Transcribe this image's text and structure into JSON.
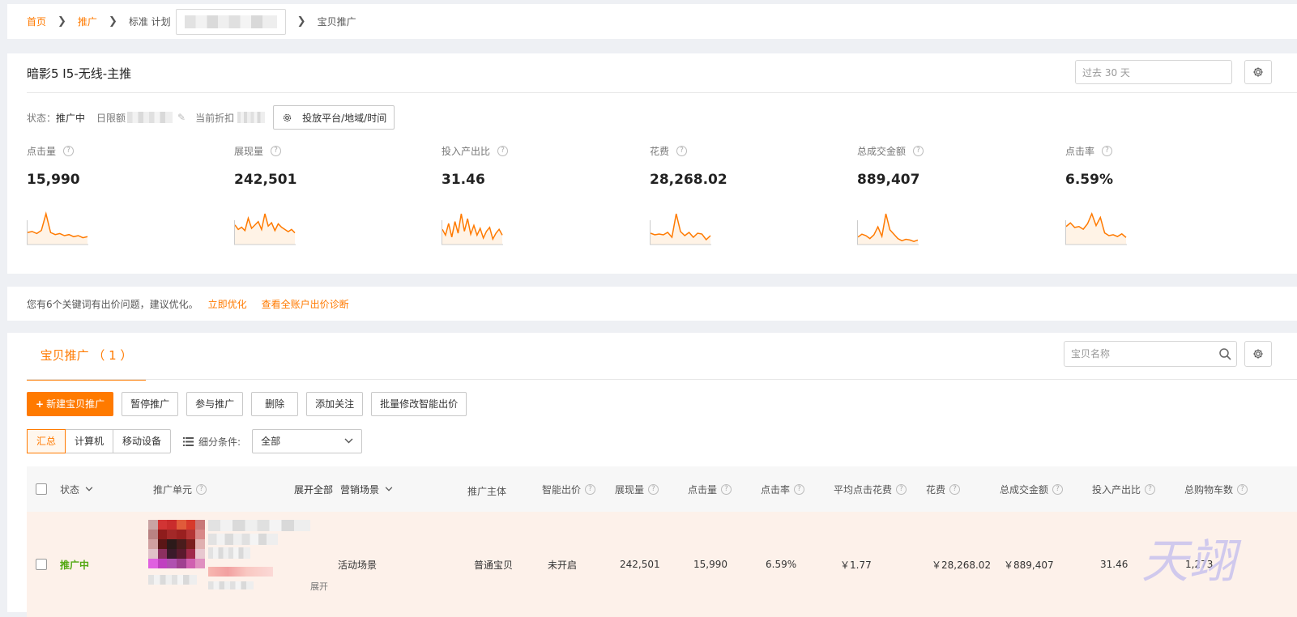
{
  "breadcrumb": {
    "home": "首页",
    "promo": "推广",
    "plan_prefix": "标准 计划",
    "current": "宝贝推广"
  },
  "overview": {
    "title": "暗影5 I5-无线-主推",
    "date_placeholder": "过去 30 天",
    "status_label": "状态：",
    "status_value": "推广中",
    "daily_limit_label": "日限额",
    "discount_label": "当前折扣",
    "platform_button": "投放平台/地域/时间",
    "metrics": [
      {
        "label": "点击量",
        "value": "15,990",
        "trend": [
          10,
          11,
          9,
          12,
          28,
          10,
          8,
          9,
          7,
          8,
          6,
          7,
          5,
          6
        ]
      },
      {
        "label": "展现量",
        "value": "242,501",
        "trend": [
          16,
          12,
          14,
          11,
          22,
          13,
          16,
          19,
          12,
          26,
          15,
          18,
          11,
          17,
          14,
          12,
          10,
          12,
          9
        ]
      },
      {
        "label": "投入产出比",
        "value": "31.46",
        "trend": [
          14,
          8,
          20,
          6,
          22,
          10,
          30,
          12,
          25,
          9,
          18,
          8,
          15,
          5,
          12,
          16,
          4,
          10,
          14,
          8
        ]
      },
      {
        "label": "花费",
        "value": "28,268.02",
        "trend": [
          12,
          10,
          11,
          10,
          13,
          7,
          36,
          14,
          9,
          13,
          7,
          12,
          11,
          4,
          9
        ]
      },
      {
        "label": "总成交金额",
        "value": "889,407",
        "trend": [
          8,
          12,
          10,
          6,
          11,
          22,
          9,
          40,
          18,
          12,
          6,
          3,
          5,
          4,
          2,
          4
        ]
      },
      {
        "label": "点击率",
        "value": "6.59%",
        "trend": [
          18,
          22,
          17,
          18,
          15,
          21,
          32,
          19,
          28,
          11,
          8,
          9,
          7,
          10,
          6
        ]
      }
    ],
    "accent_color": "#ff7a00"
  },
  "tip": {
    "text": "您有6个关键词有出价问题，建议优化。",
    "link1": "立即优化",
    "link2": "查看全账户出价诊断"
  },
  "list": {
    "tab_label": "宝贝推广 （ 1 ）",
    "search_placeholder": "宝贝名称",
    "buttons": {
      "new": "新建宝贝推广",
      "pause": "暂停推广",
      "join": "参与推广",
      "delete": "删除",
      "follow": "添加关注",
      "batch_bid": "批量修改智能出价"
    },
    "devices": [
      "汇总",
      "计算机",
      "移动设备"
    ],
    "condition_label": "细分条件:",
    "condition_value": "全部",
    "columns": {
      "status": "状态",
      "unit": "推广单元",
      "expand_all": "展开全部",
      "scene": "营销场景",
      "subject": "推广主体",
      "smart_bid": "智能出价",
      "impressions": "展现量",
      "clicks": "点击量",
      "ctr": "点击率",
      "avg_cpc": "平均点击花费",
      "cost": "花费",
      "gmv": "总成交金额",
      "roi": "投入产出比",
      "cart": "总购物车数"
    },
    "row": {
      "status": "推广中",
      "expand": "展开",
      "scene": "活动场景",
      "subject": "普通宝贝",
      "smart_bid": "未开启",
      "impressions": "242,501",
      "clicks": "15,990",
      "ctr": "6.59%",
      "avg_cpc": "￥1.77",
      "cost": "￥28,268.02",
      "gmv": "￥889,407",
      "roi": "31.46",
      "cart": "1,273"
    }
  },
  "watermark": "天翊"
}
